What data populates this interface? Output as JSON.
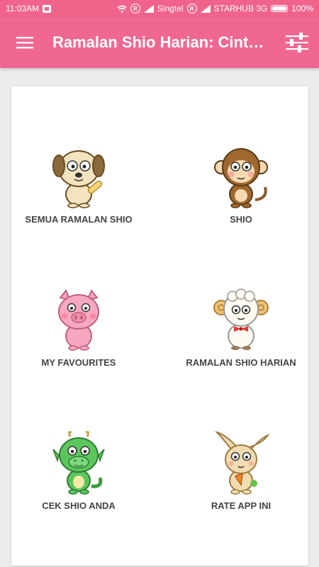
{
  "status_bar": {
    "time": "11:03AM",
    "carrier1": "Singtel",
    "carrier2": "STARHUB 3G",
    "battery": "100%",
    "sim_mark": "R"
  },
  "appbar": {
    "title": "Ramalan Shio Harian: Cint…",
    "menu_icon": "hamburger-menu-icon",
    "filter_icon": "sliders-icon",
    "color": "#f06892"
  },
  "menu": {
    "items": [
      {
        "label": "SEMUA RAMALAN SHIO",
        "icon": "dog-icon"
      },
      {
        "label": "SHIO",
        "icon": "monkey-icon"
      },
      {
        "label": "MY FAVOURITES",
        "icon": "pig-icon"
      },
      {
        "label": "RAMALAN SHIO HARIAN",
        "icon": "sheep-icon"
      },
      {
        "label": "CEK SHIO ANDA",
        "icon": "dragon-icon"
      },
      {
        "label": "RATE APP INI",
        "icon": "rabbit-icon"
      }
    ]
  }
}
